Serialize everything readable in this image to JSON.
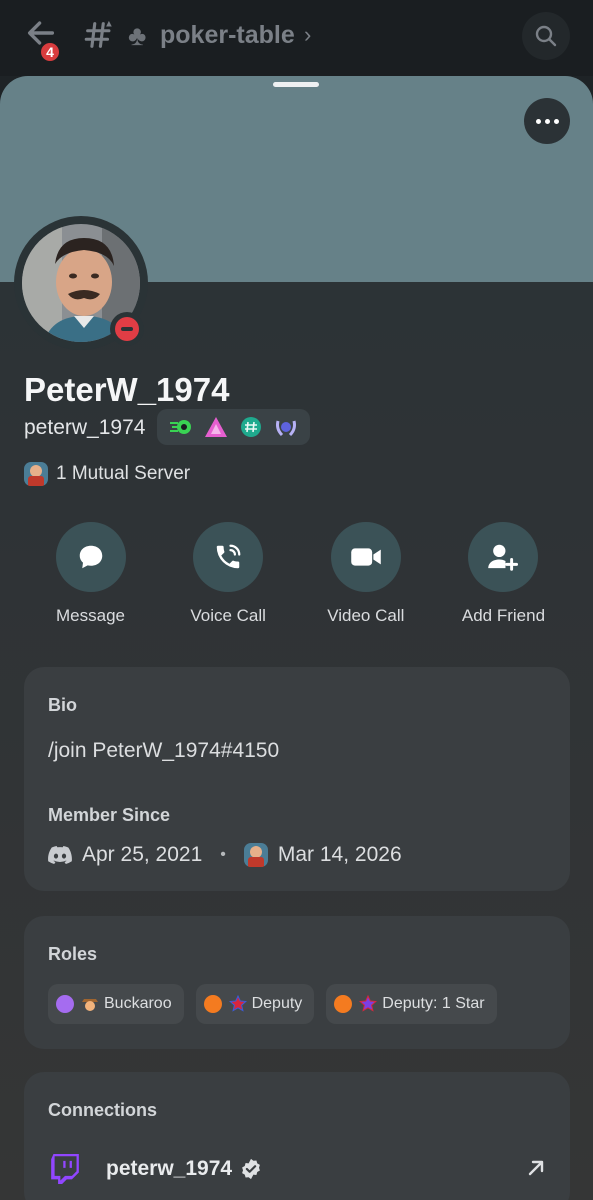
{
  "topbar": {
    "notification_count": "4",
    "channel_name": "poker-table"
  },
  "profile": {
    "display_name": "PeterW_1974",
    "username": "peterw_1974",
    "mutual_servers": "1 Mutual Server",
    "status": "do-not-disturb",
    "banner_color": "#668188"
  },
  "actions": [
    {
      "label": "Message",
      "icon": "chat-bubble-icon"
    },
    {
      "label": "Voice Call",
      "icon": "phone-icon"
    },
    {
      "label": "Video Call",
      "icon": "video-camera-icon"
    },
    {
      "label": "Add Friend",
      "icon": "add-friend-icon"
    }
  ],
  "bio": {
    "title": "Bio",
    "text": "/join PeterW_1974#4150",
    "member_since_title": "Member Since",
    "discord_date": "Apr 25, 2021",
    "server_date": "Mar 14, 2026"
  },
  "roles": {
    "title": "Roles",
    "items": [
      {
        "name": "Buckaroo",
        "color": "#a56cf0"
      },
      {
        "name": "Deputy",
        "color": "#f47b20"
      },
      {
        "name": "Deputy: 1 Star",
        "color": "#f47b20"
      }
    ]
  },
  "connections": {
    "title": "Connections",
    "items": [
      {
        "service": "twitch",
        "name": "peterw_1974",
        "verified": true
      }
    ]
  }
}
